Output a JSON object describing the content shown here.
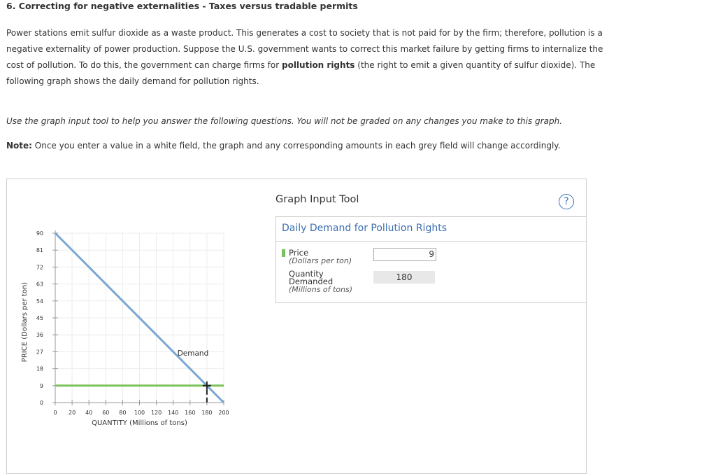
{
  "question": {
    "title": "6. Correcting for negative externalities - Taxes versus tradable permits",
    "para_1": "Power stations emit sulfur dioxide as a waste product. This generates a cost to society that is not paid for by the firm; therefore, pollution is a negative externality of power production. Suppose the U.S. government wants to correct this market failure by getting firms to internalize the cost of pollution. To do this, the government can charge firms for ",
    "para_bold": "pollution rights",
    "para_2": " (the right to emit a given quantity of sulfur dioxide). The following graph shows the daily demand for pollution rights.",
    "instruction": "Use the graph input tool to help you answer the following questions. You will not be graded on any changes you make to this graph.",
    "note_label": "Note:",
    "note_text": " Once you enter a value in a white field, the graph and any corresponding amounts in each grey field will change accordingly."
  },
  "tool": {
    "title": "Graph Input Tool",
    "help": "?",
    "heading": "Daily Demand for Pollution Rights",
    "price_label": "Price",
    "price_unit": "(Dollars per ton)",
    "price_value": "9",
    "qty_label_1": "Quantity",
    "qty_label_2": "Demanded",
    "qty_unit": "(Millions of tons)",
    "qty_value": "180"
  },
  "colors": {
    "demand": "#7ba6d3",
    "price_line": "#7ac35c",
    "accent": "#3b6fb0"
  },
  "chart_data": {
    "type": "line",
    "xlabel": "QUANTITY (Millions of tons)",
    "ylabel": "PRICE (Dollars per ton)",
    "xlim": [
      0,
      200
    ],
    "ylim": [
      0,
      90
    ],
    "x_ticks": [
      0,
      20,
      40,
      60,
      80,
      100,
      120,
      140,
      160,
      180,
      200
    ],
    "y_ticks": [
      0,
      9,
      18,
      27,
      36,
      45,
      54,
      63,
      72,
      81,
      90
    ],
    "grid": true,
    "series": [
      {
        "name": "Demand",
        "x": [
          0,
          200
        ],
        "y": [
          90,
          0
        ]
      }
    ],
    "price_line": 9,
    "marker": {
      "x": 180,
      "y": 9
    }
  }
}
